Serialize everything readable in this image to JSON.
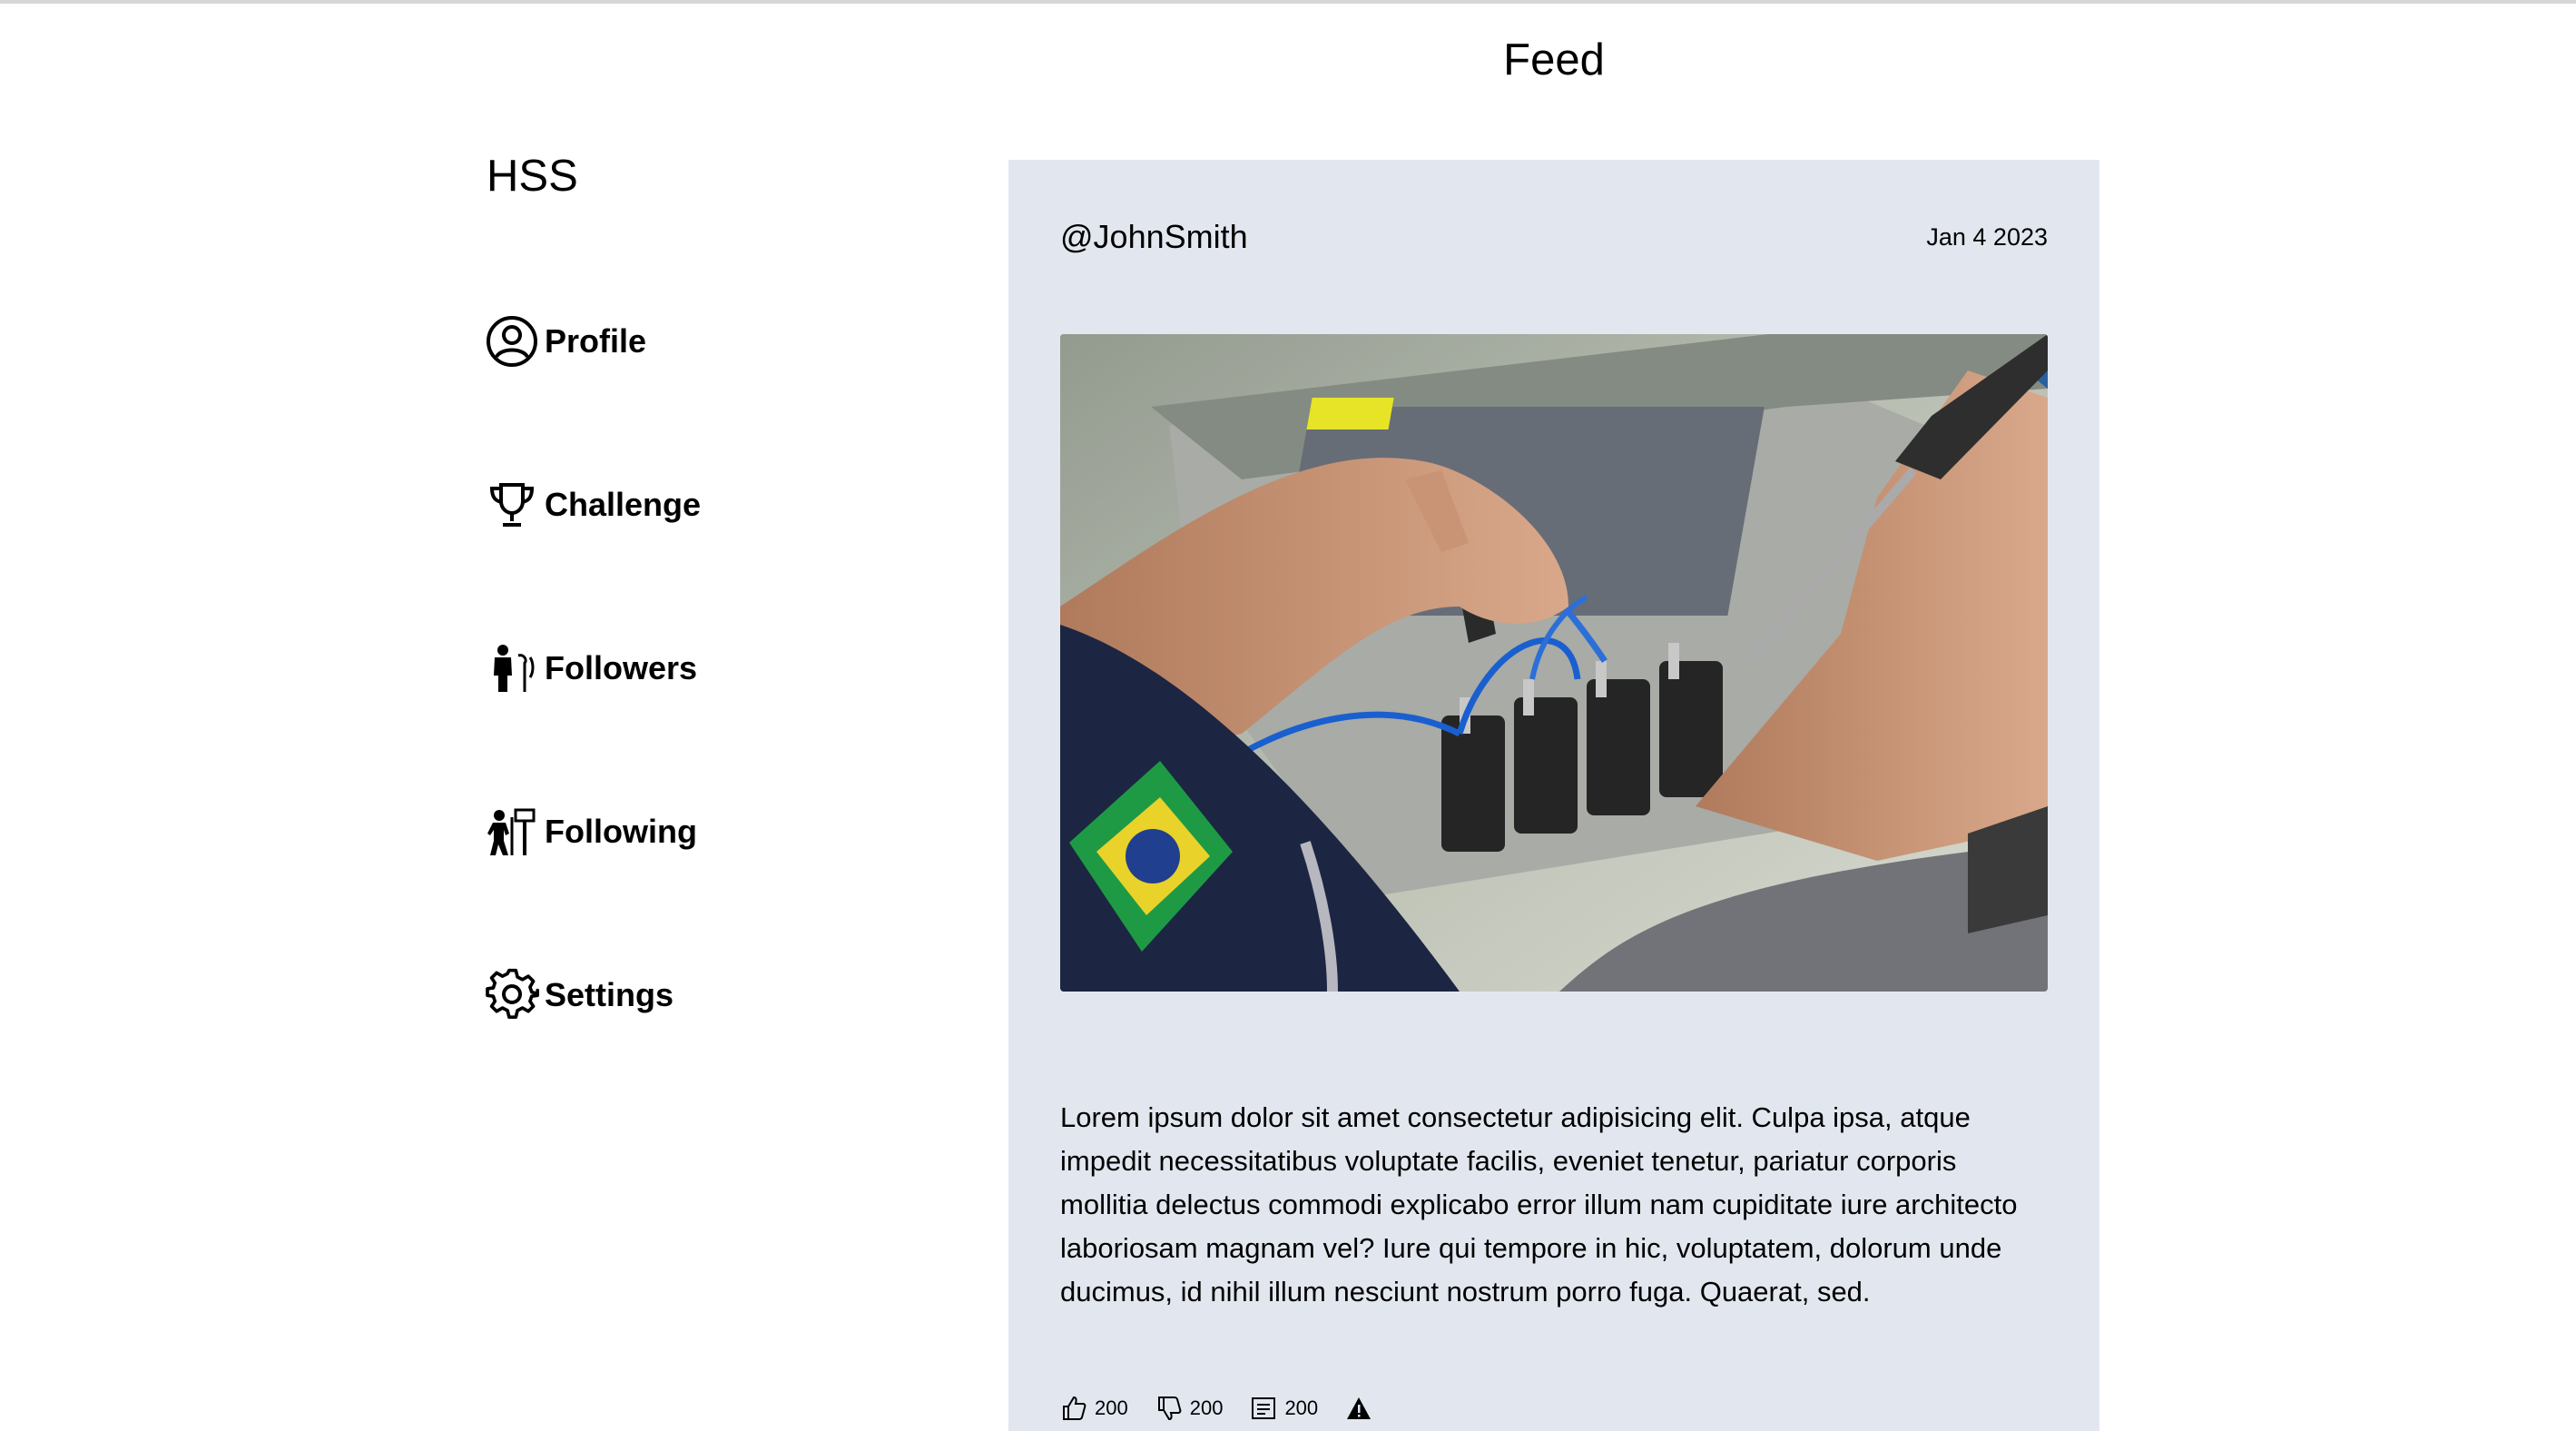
{
  "header": {
    "title": "Feed"
  },
  "sidebar": {
    "brand": "HSS",
    "items": [
      {
        "label": "Profile",
        "icon": "user-circle-icon"
      },
      {
        "label": "Challenge",
        "icon": "trophy-icon"
      },
      {
        "label": "Followers",
        "icon": "followers-icon"
      },
      {
        "label": "Following",
        "icon": "following-icon"
      },
      {
        "label": "Settings",
        "icon": "gear-icon"
      }
    ]
  },
  "post": {
    "username": "@JohnSmith",
    "date": "Jan 4 2023",
    "image_alt": "Hands soldering blue wires onto electronic connectors",
    "body": "Lorem ipsum dolor sit amet consectetur adipisicing elit. Culpa ipsa, atque impedit necessitatibus voluptate facilis, eveniet tenetur, pariatur corporis mollitia delectus commodi explicabo error illum nam cupiditate iure architecto laboriosam magnam vel? Iure qui tempore in hic, voluptatem, dolorum unde ducimus, id nihil illum nesciunt nostrum porro fuga. Quaerat, sed.",
    "actions": {
      "likes": "200",
      "dislikes": "200",
      "comments": "200",
      "report_icon": "warning-icon"
    }
  },
  "colors": {
    "card_bg": "#e2e7ef",
    "text": "#000000"
  }
}
